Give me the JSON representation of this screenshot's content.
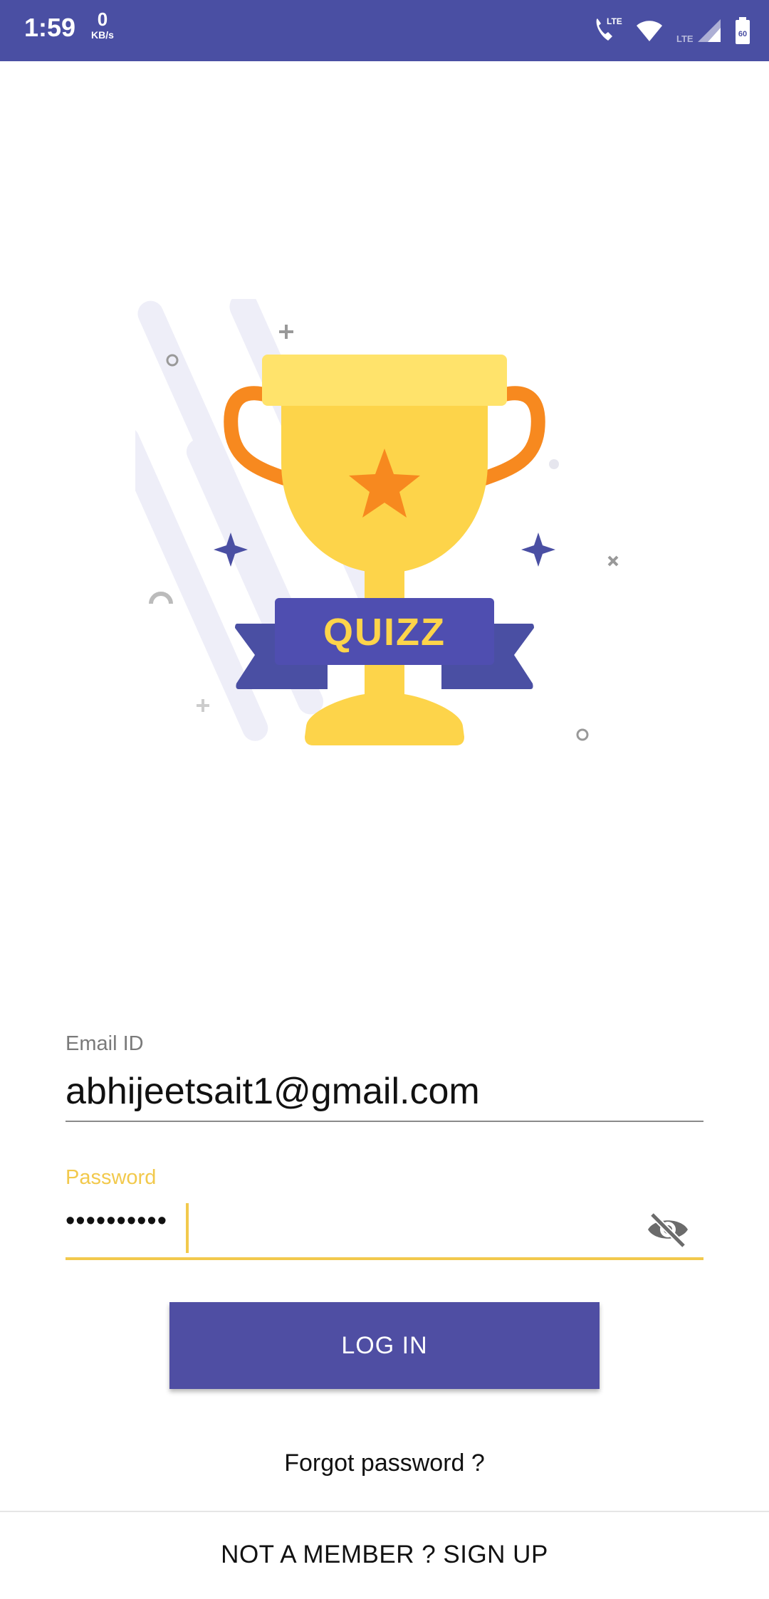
{
  "status_bar": {
    "time": "1:59",
    "speed_value": "0",
    "speed_unit": "KB/s",
    "network_label": "LTE",
    "signal_label": "LTE",
    "battery_label": "60"
  },
  "logo": {
    "text": "QUIZZ"
  },
  "login_form": {
    "email_label": "Email ID",
    "email_value": "abhijeetsait1@gmail.com",
    "password_label": "Password",
    "password_value": "••••••••••",
    "login_button": "LOG IN",
    "forgot_password": "Forgot password ?",
    "signup": "NOT A MEMBER ? SIGN UP"
  },
  "colors": {
    "primary": "#4f4ea3",
    "accent": "#f2c94c",
    "trophy": "#fdd44a",
    "orange": "#f7891f"
  }
}
